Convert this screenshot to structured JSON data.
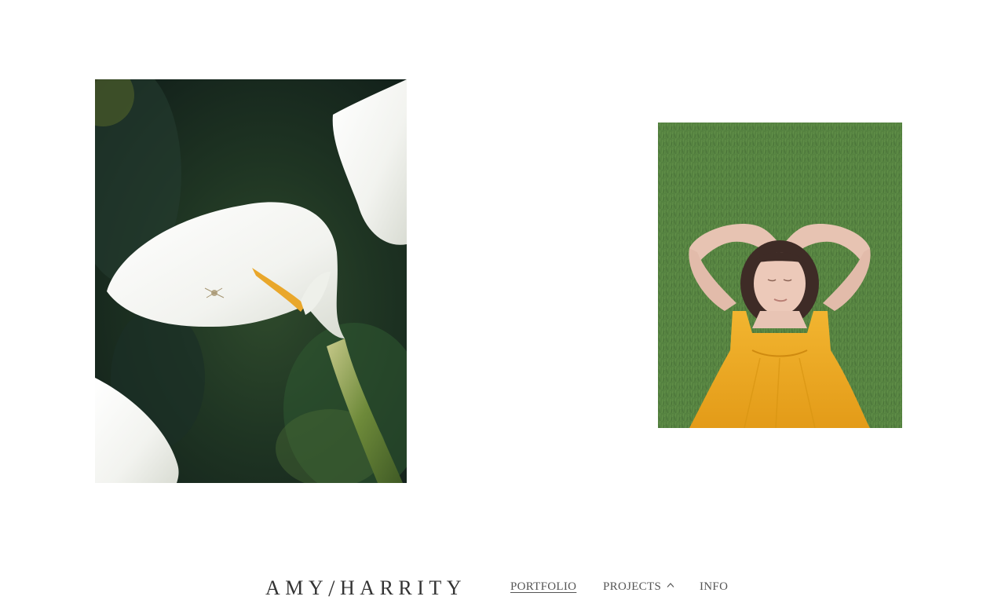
{
  "site": {
    "logo_left": "AMY",
    "logo_slash": "/",
    "logo_right": "HARRITY"
  },
  "nav": {
    "items": [
      {
        "label": "PORTFOLIO",
        "active": true
      },
      {
        "label": "PROJECTS",
        "has_dropdown": true
      },
      {
        "label": "INFO"
      }
    ]
  },
  "gallery": {
    "images": [
      {
        "alt": "white calla lily with small spider"
      },
      {
        "alt": "woman in yellow dress lying on grass"
      }
    ]
  },
  "icons": {
    "projects_dropdown": "chevron-up-icon"
  },
  "colors": {
    "background": "#ffffff",
    "text": "#333333",
    "nav_text": "#555555"
  }
}
